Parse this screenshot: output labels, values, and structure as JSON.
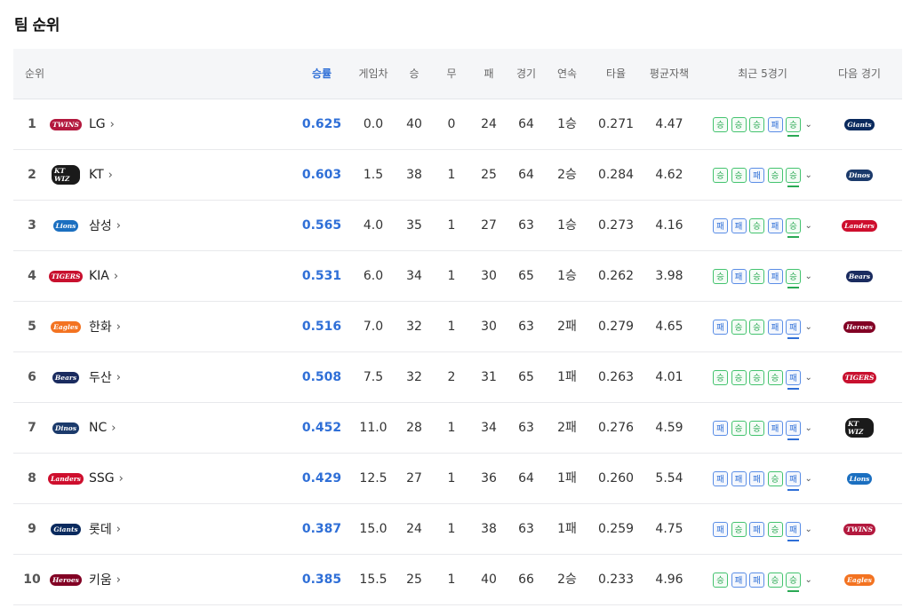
{
  "title": "팀 순위",
  "headers": {
    "rank": "순위",
    "pct": "승률",
    "gb": "게임차",
    "w": "승",
    "d": "무",
    "l": "패",
    "g": "경기",
    "streak": "연속",
    "avg": "타율",
    "era": "평균자책",
    "recent": "최근 5경기",
    "next": "다음 경기"
  },
  "colors": {
    "accent": "#2f6fd7",
    "win_chip": "#2aa954",
    "loss_chip": "#2f6fd7",
    "LG": "#b3193e",
    "KT": "#1a1a1a",
    "Samsung": "#1b6fc0",
    "KIA": "#c8102e",
    "Hanwha": "#f37321",
    "Doosan": "#1a2b5f",
    "NC": "#1b3a6b",
    "SSG": "#ce0e2d",
    "Lotte": "#0a2a5e",
    "Kiwoom": "#820024"
  },
  "rows": [
    {
      "rank": "1",
      "team": "LG",
      "pct": "0.625",
      "gb": "0.0",
      "w": "40",
      "d": "0",
      "l": "24",
      "g": "64",
      "streak": "1승",
      "avg": "0.271",
      "era": "4.47",
      "recent": [
        "승",
        "승",
        "승",
        "패",
        "승"
      ],
      "logo_icon": "lg-twins-logo-icon",
      "logo_text": "TWINS",
      "next_icon": "lotte-giants-logo-icon",
      "next_text": "Giants"
    },
    {
      "rank": "2",
      "team": "KT",
      "pct": "0.603",
      "gb": "1.5",
      "w": "38",
      "d": "1",
      "l": "25",
      "g": "64",
      "streak": "2승",
      "avg": "0.284",
      "era": "4.62",
      "recent": [
        "승",
        "승",
        "패",
        "승",
        "승"
      ],
      "logo_icon": "kt-wiz-logo-icon",
      "logo_text": "KT WIZ",
      "next_icon": "nc-dinos-logo-icon",
      "next_text": "Dinos"
    },
    {
      "rank": "3",
      "team": "삼성",
      "pct": "0.565",
      "gb": "4.0",
      "w": "35",
      "d": "1",
      "l": "27",
      "g": "63",
      "streak": "1승",
      "avg": "0.273",
      "era": "4.16",
      "recent": [
        "패",
        "패",
        "승",
        "패",
        "승"
      ],
      "logo_icon": "samsung-lions-logo-icon",
      "logo_text": "Lions",
      "next_icon": "ssg-landers-logo-icon",
      "next_text": "Landers"
    },
    {
      "rank": "4",
      "team": "KIA",
      "pct": "0.531",
      "gb": "6.0",
      "w": "34",
      "d": "1",
      "l": "30",
      "g": "65",
      "streak": "1승",
      "avg": "0.262",
      "era": "3.98",
      "recent": [
        "승",
        "패",
        "승",
        "패",
        "승"
      ],
      "logo_icon": "kia-tigers-logo-icon",
      "logo_text": "TIGERS",
      "next_icon": "doosan-bears-logo-icon",
      "next_text": "Bears"
    },
    {
      "rank": "5",
      "team": "한화",
      "pct": "0.516",
      "gb": "7.0",
      "w": "32",
      "d": "1",
      "l": "30",
      "g": "63",
      "streak": "2패",
      "avg": "0.279",
      "era": "4.65",
      "recent": [
        "패",
        "승",
        "승",
        "패",
        "패"
      ],
      "logo_icon": "hanwha-eagles-logo-icon",
      "logo_text": "Eagles",
      "next_icon": "kiwoom-heroes-logo-icon",
      "next_text": "Heroes"
    },
    {
      "rank": "6",
      "team": "두산",
      "pct": "0.508",
      "gb": "7.5",
      "w": "32",
      "d": "2",
      "l": "31",
      "g": "65",
      "streak": "1패",
      "avg": "0.263",
      "era": "4.01",
      "recent": [
        "승",
        "승",
        "승",
        "승",
        "패"
      ],
      "logo_icon": "doosan-bears-logo-icon",
      "logo_text": "Bears",
      "next_icon": "kia-tigers-logo-icon",
      "next_text": "TIGERS"
    },
    {
      "rank": "7",
      "team": "NC",
      "pct": "0.452",
      "gb": "11.0",
      "w": "28",
      "d": "1",
      "l": "34",
      "g": "63",
      "streak": "2패",
      "avg": "0.276",
      "era": "4.59",
      "recent": [
        "패",
        "승",
        "승",
        "패",
        "패"
      ],
      "logo_icon": "nc-dinos-logo-icon",
      "logo_text": "Dinos",
      "next_icon": "kt-wiz-logo-icon",
      "next_text": "KT WIZ"
    },
    {
      "rank": "8",
      "team": "SSG",
      "pct": "0.429",
      "gb": "12.5",
      "w": "27",
      "d": "1",
      "l": "36",
      "g": "64",
      "streak": "1패",
      "avg": "0.260",
      "era": "5.54",
      "recent": [
        "패",
        "패",
        "패",
        "승",
        "패"
      ],
      "logo_icon": "ssg-landers-logo-icon",
      "logo_text": "Landers",
      "next_icon": "samsung-lions-logo-icon",
      "next_text": "Lions"
    },
    {
      "rank": "9",
      "team": "롯데",
      "pct": "0.387",
      "gb": "15.0",
      "w": "24",
      "d": "1",
      "l": "38",
      "g": "63",
      "streak": "1패",
      "avg": "0.259",
      "era": "4.75",
      "recent": [
        "패",
        "승",
        "패",
        "승",
        "패"
      ],
      "logo_icon": "lotte-giants-logo-icon",
      "logo_text": "Giants",
      "next_icon": "lg-twins-logo-icon",
      "next_text": "TWINS"
    },
    {
      "rank": "10",
      "team": "키움",
      "pct": "0.385",
      "gb": "15.5",
      "w": "25",
      "d": "1",
      "l": "40",
      "g": "66",
      "streak": "2승",
      "avg": "0.233",
      "era": "4.96",
      "recent": [
        "승",
        "패",
        "패",
        "승",
        "승"
      ],
      "logo_icon": "kiwoom-heroes-logo-icon",
      "logo_text": "Heroes",
      "next_icon": "hanwha-eagles-logo-icon",
      "next_text": "Eagles"
    }
  ]
}
